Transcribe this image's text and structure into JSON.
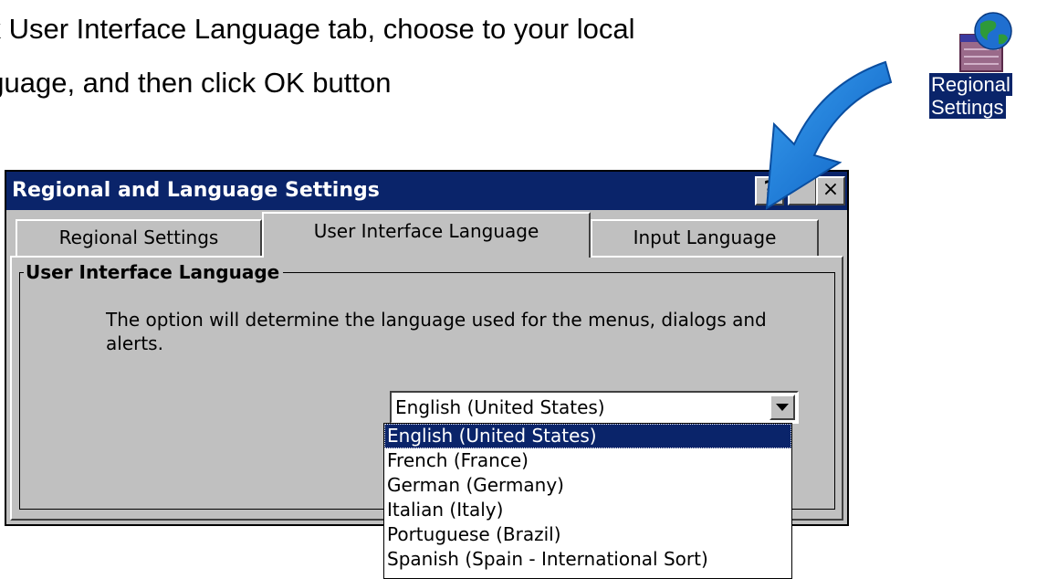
{
  "instruction": {
    "line1": "ck User Interface Language tab, choose to your local",
    "line2": "nguage, and then click OK button"
  },
  "desktop_icon": {
    "icon": "regional-settings-globe-icon",
    "label_line1": "Regional",
    "label_line2": "Settings"
  },
  "dialog": {
    "title": "Regional and Language Settings",
    "help_label": "?",
    "close_label": "×",
    "tabs": [
      {
        "label": "Regional Settings"
      },
      {
        "label": "User Interface Language"
      },
      {
        "label": "Input Language"
      }
    ],
    "active_tab": "User Interface Language",
    "group_title": "User Interface Language",
    "description": "The option will determine the language used for the menus, dialogs and alerts.",
    "combo": {
      "selected": "English (United States)"
    },
    "options": [
      "English (United States)",
      "French (France)",
      "German (Germany)",
      "Italian (Italy)",
      "Portuguese (Brazil)",
      "Spanish (Spain - International Sort)"
    ]
  },
  "colors": {
    "titlebar": "#0a246a",
    "dialog_bg": "#c0c0c0",
    "arrow": "#1a7fd4"
  }
}
